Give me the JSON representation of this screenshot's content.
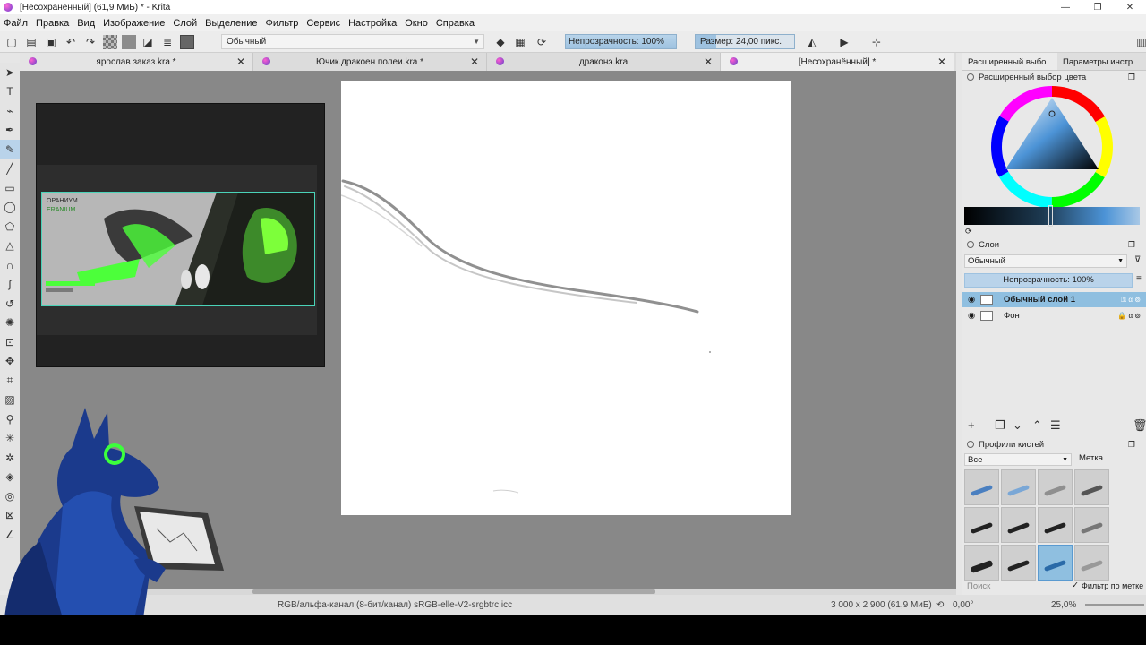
{
  "window": {
    "title": "[Несохранённый]  (61,9 МиБ)  * - Krita",
    "controls": [
      "—",
      "❐",
      "✕"
    ]
  },
  "menu": [
    "Файл",
    "Правка",
    "Вид",
    "Изображение",
    "Слой",
    "Выделение",
    "Фильтр",
    "Сервис",
    "Настройка",
    "Окно",
    "Справка"
  ],
  "toolbar": {
    "preset_name": "Обычный",
    "opacity_label": "Непрозрачность: 100%",
    "size_label": "Размер: 24,00 пикс."
  },
  "tabs": [
    {
      "label": "ярослав заказ.kra *"
    },
    {
      "label": "Ючик.дракоен  полеи.kra *"
    },
    {
      "label": "драконэ.kra"
    },
    {
      "label": "[Несохранённый]  *"
    }
  ],
  "reference": {
    "title_ru": "ОРАНИУМ",
    "title_en": "ERANIUM"
  },
  "status": {
    "color_info": "RGB/альфа-канал (8-бит/канал)  sRGB-elle-V2-srgbtrc.icc",
    "dimensions": "3 000 x 2 900 (61,9 МиБ)",
    "rotation": "0,00°",
    "zoom": "25,0%"
  },
  "dock": {
    "tabs": [
      "Расширенный выбо...",
      "Параметры инстр..."
    ],
    "color_panel_title": "Расширенный выбор цвета",
    "layers_title": "Слои",
    "blend_mode": "Обычный",
    "layer_opacity": "Непрозрачность: 100%",
    "layers": [
      {
        "name": "Обычный слой 1",
        "selected": true
      },
      {
        "name": "Фон",
        "selected": false
      }
    ],
    "brush_title": "Профили кистей",
    "brush_filter": "Все",
    "brush_tag_label": "Метка",
    "search_placeholder": "Поиск",
    "filter_by_tag": "Фильтр по метке"
  },
  "colors": {
    "accent_blue": "#9ec2e0",
    "canvas_bg": "#888888",
    "reference_green": "#4cff3a"
  }
}
